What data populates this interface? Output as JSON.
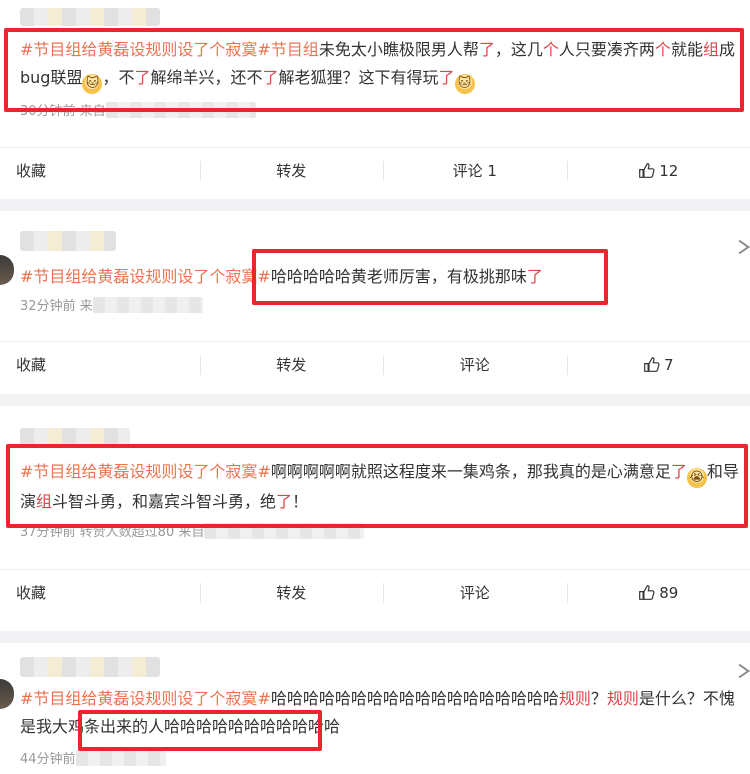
{
  "colors": {
    "topic": "#eb7350",
    "highlight": "#e0434a",
    "annotation": "#e8262d"
  },
  "posts": [
    {
      "text": [
        {
          "t": "#节目组给黄磊设规则设了个寂寞#",
          "c": "tag"
        },
        {
          "t": "节目组",
          "c": "tag"
        },
        {
          "t": "未免太小瞧极限男人帮",
          "c": ""
        },
        {
          "t": "了",
          "c": "hl"
        },
        {
          "t": "，这几",
          "c": ""
        },
        {
          "t": "个",
          "c": "hl"
        },
        {
          "t": "人只要凑齐两",
          "c": ""
        },
        {
          "t": "个",
          "c": "hl"
        },
        {
          "t": "就能",
          "c": ""
        },
        {
          "t": "组",
          "c": "hl"
        },
        {
          "t": "成bug联盟",
          "c": ""
        },
        {
          "t": "🐱",
          "c": "emoji"
        },
        {
          "t": "，不",
          "c": ""
        },
        {
          "t": "了",
          "c": "hl"
        },
        {
          "t": "解绵羊兴，还不",
          "c": ""
        },
        {
          "t": "了",
          "c": "hl"
        },
        {
          "t": "解老狐狸？这下有得玩",
          "c": ""
        },
        {
          "t": "了",
          "c": "hl"
        },
        {
          "t": "🐱",
          "c": "emoji"
        }
      ],
      "meta": "30分钟前 来自",
      "actions": {
        "collect": "收藏",
        "repost": "转发",
        "comment": "评论 1",
        "like": "12"
      }
    },
    {
      "text": [
        {
          "t": "#节目组给黄磊设规则设了个寂寞#",
          "c": "tag"
        },
        {
          "t": "哈哈哈哈哈黄老师厉害，有极挑那味",
          "c": ""
        },
        {
          "t": "了",
          "c": "hl"
        }
      ],
      "meta": "32分钟前 来",
      "actions": {
        "collect": "收藏",
        "repost": "转发",
        "comment": "评论",
        "like": "7"
      }
    },
    {
      "text": [
        {
          "t": "#节目组给黄磊设规则设了个寂寞#",
          "c": "tag"
        },
        {
          "t": "啊啊啊啊啊就照这程度来一集鸡条，那我真的是心满意足",
          "c": ""
        },
        {
          "t": "了",
          "c": "hl"
        },
        {
          "t": "😭",
          "c": "emoji"
        },
        {
          "t": "和导演",
          "c": ""
        },
        {
          "t": "组",
          "c": "hl"
        },
        {
          "t": "斗智斗勇，和嘉宾斗智斗勇，绝",
          "c": ""
        },
        {
          "t": "了",
          "c": "hl"
        },
        {
          "t": "！",
          "c": ""
        }
      ],
      "meta": "37分钟前 转赞人数超过80 来自",
      "actions": {
        "collect": "收藏",
        "repost": "转发",
        "comment": "评论",
        "like": "89"
      }
    },
    {
      "text": [
        {
          "t": "#节目组给黄磊设规则设了个寂寞#",
          "c": "tag"
        },
        {
          "t": "哈哈哈哈哈哈哈哈哈哈哈哈哈哈哈哈哈哈",
          "c": ""
        },
        {
          "t": "规则",
          "c": "hl"
        },
        {
          "t": "？",
          "c": ""
        },
        {
          "t": "规则",
          "c": "hl"
        },
        {
          "t": "是什么？不愧是我大鸡条出来的人哈哈哈哈哈哈哈哈哈哈哈",
          "c": ""
        }
      ],
      "meta": "44分钟前",
      "actions": null
    }
  ]
}
